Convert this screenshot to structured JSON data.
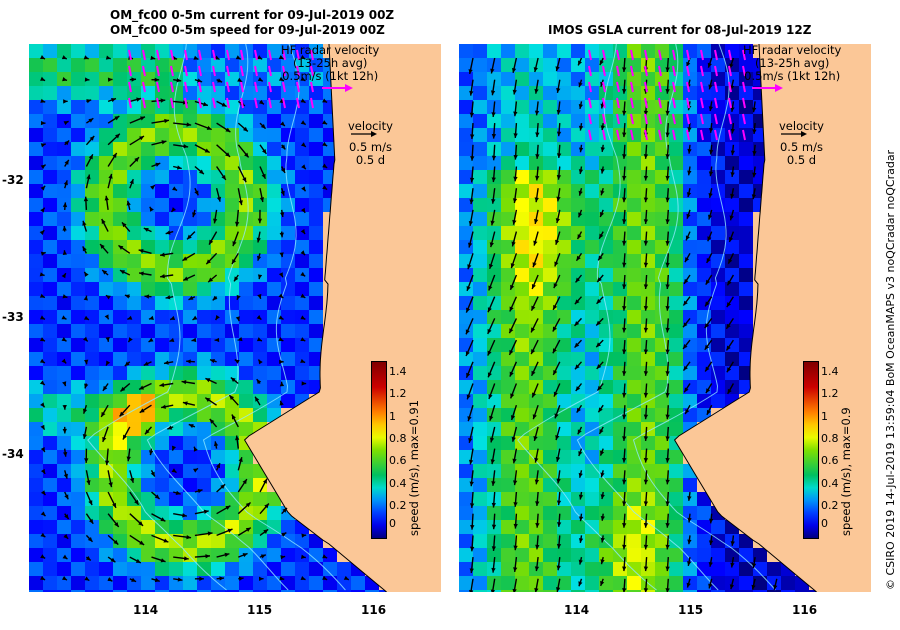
{
  "left_panel": {
    "title_line1": "OM_fc00 0-5m current for 09-Jul-2019 00Z",
    "title_line2": "OM_fc00 0-5m speed for 09-Jul-2019 00Z",
    "hf_legend": [
      "HF radar velocity",
      "(13-25h avg)",
      "0.5m/s (1kt 12h)"
    ],
    "vel_legend": [
      "velocity",
      "0.5 m/s",
      "0.5 d"
    ],
    "colorbar_label": "speed (m/s), max=0.91"
  },
  "right_panel": {
    "title_line1": "IMOS GSLA current for 08-Jul-2019 12Z",
    "hf_legend": [
      "HF radar velocity",
      "(13-25h avg)",
      "0.5m/s (1kt 12h)"
    ],
    "vel_legend": [
      "velocity",
      "0.5 m/s",
      "0.5 d"
    ],
    "colorbar_label": "speed (m/s), max=0.9"
  },
  "lat_ticks": [
    "-32",
    "-33",
    "-34"
  ],
  "lon_ticks": [
    "114",
    "115",
    "116"
  ],
  "colorbar_ticks": [
    "1.4",
    "1.2",
    "1",
    "0.8",
    "0.6",
    "0.4",
    "0.2",
    "0"
  ],
  "credit": "© CSIRO 2019   14-Jul-2019 13:59:04 BoM OceanMAPS v3 noQCradar noQCradar",
  "colors": {
    "land": "#fbc797",
    "hf_arrow": "#ff00ff",
    "speed_scale": [
      "#000080",
      "#0000ff",
      "#0080ff",
      "#00e0e0",
      "#00c060",
      "#80e000",
      "#ffff00",
      "#ff8000",
      "#cc0000",
      "#800000"
    ]
  }
}
